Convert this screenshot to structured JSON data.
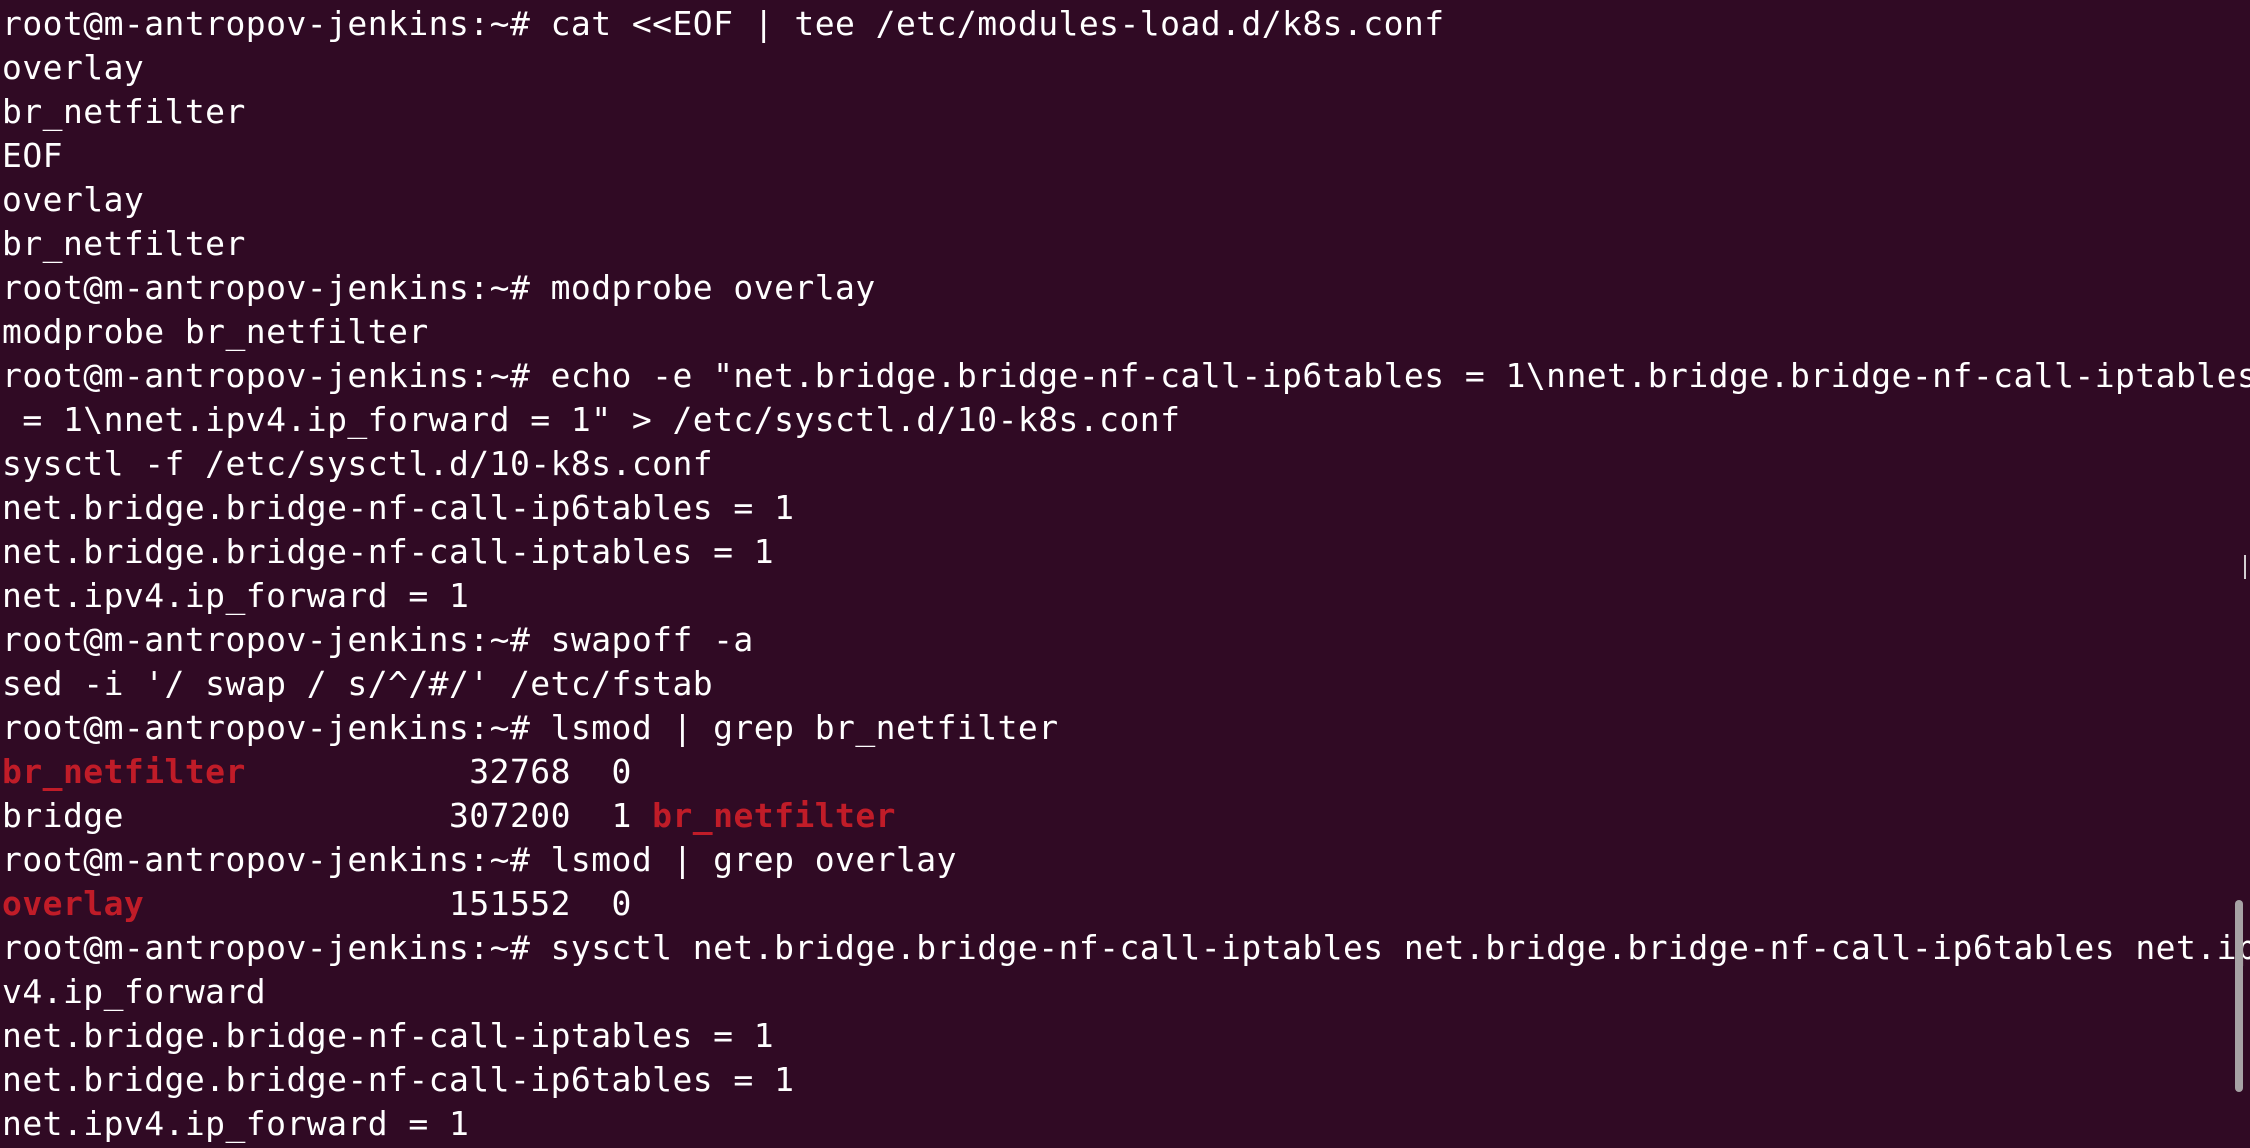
{
  "terminal": {
    "background": "#300a24",
    "foreground": "#ffffff",
    "highlight_color": "#c01c28",
    "lines": [
      [
        {
          "t": "root@m-antropov-jenkins:~# cat <<EOF | tee /etc/modules-load.d/k8s.conf"
        }
      ],
      [
        {
          "t": "overlay"
        }
      ],
      [
        {
          "t": "br_netfilter"
        }
      ],
      [
        {
          "t": "EOF"
        }
      ],
      [
        {
          "t": "overlay"
        }
      ],
      [
        {
          "t": "br_netfilter"
        }
      ],
      [
        {
          "t": "root@m-antropov-jenkins:~# modprobe overlay"
        }
      ],
      [
        {
          "t": "modprobe br_netfilter"
        }
      ],
      [
        {
          "t": "root@m-antropov-jenkins:~# echo -e \"net.bridge.bridge-nf-call-ip6tables = 1\\nnet.bridge.bridge-nf-call-iptables"
        }
      ],
      [
        {
          "t": " = 1\\nnet.ipv4.ip_forward = 1\" > /etc/sysctl.d/10-k8s.conf"
        }
      ],
      [
        {
          "t": "sysctl -f /etc/sysctl.d/10-k8s.conf"
        }
      ],
      [
        {
          "t": "net.bridge.bridge-nf-call-ip6tables = 1"
        }
      ],
      [
        {
          "t": "net.bridge.bridge-nf-call-iptables = 1"
        }
      ],
      [
        {
          "t": "net.ipv4.ip_forward = 1"
        }
      ],
      [
        {
          "t": "root@m-antropov-jenkins:~# swapoff -a"
        }
      ],
      [
        {
          "t": "sed -i '/ swap / s/^/#/' /etc/fstab"
        }
      ],
      [
        {
          "t": "root@m-antropov-jenkins:~# lsmod | grep br_netfilter"
        }
      ],
      [
        {
          "t": "br_netfilter",
          "hl": true
        },
        {
          "t": "           32768  0"
        }
      ],
      [
        {
          "t": "bridge                307200  1 "
        },
        {
          "t": "br_netfilter",
          "hl": true
        }
      ],
      [
        {
          "t": "root@m-antropov-jenkins:~# lsmod | grep overlay"
        }
      ],
      [
        {
          "t": "overlay",
          "hl": true
        },
        {
          "t": "               151552  0"
        }
      ],
      [
        {
          "t": "root@m-antropov-jenkins:~# sysctl net.bridge.bridge-nf-call-iptables net.bridge.bridge-nf-call-ip6tables net.ip"
        }
      ],
      [
        {
          "t": "v4.ip_forward"
        }
      ],
      [
        {
          "t": "net.bridge.bridge-nf-call-iptables = 1"
        }
      ],
      [
        {
          "t": "net.bridge.bridge-nf-call-ip6tables = 1"
        }
      ],
      [
        {
          "t": "net.ipv4.ip_forward = 1"
        }
      ]
    ]
  }
}
